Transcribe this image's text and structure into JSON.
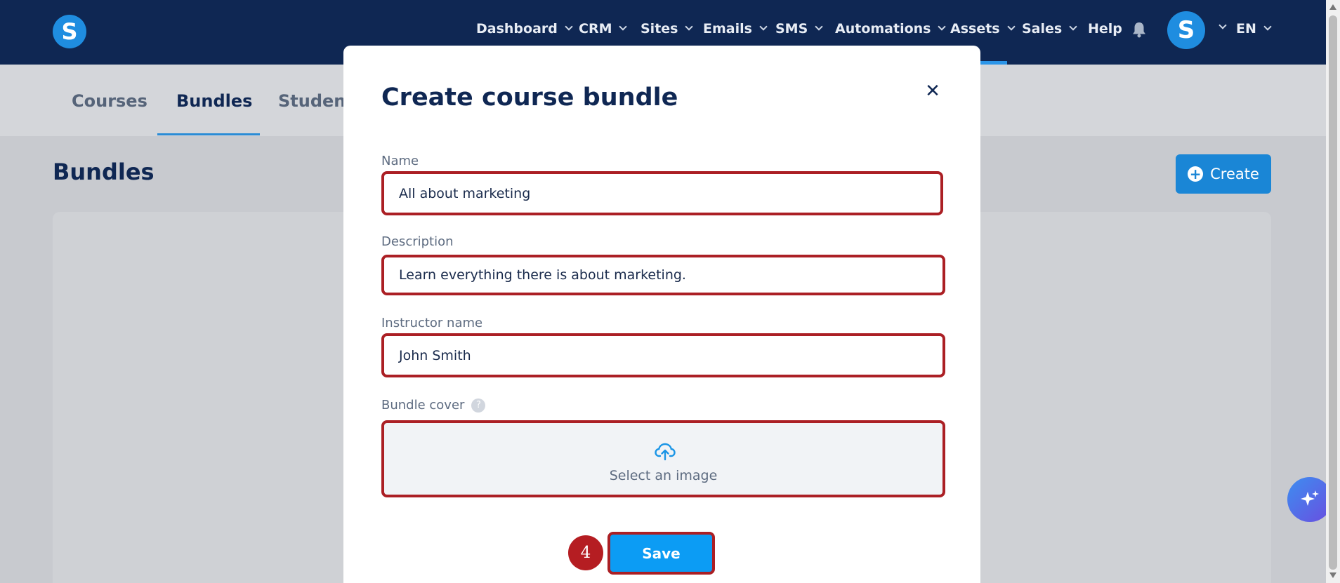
{
  "brand": {
    "logo_letter": "S"
  },
  "topnav": {
    "items": [
      {
        "label": "Dashboard",
        "has_menu": true
      },
      {
        "label": "CRM",
        "has_menu": true
      },
      {
        "label": "Sites",
        "has_menu": true
      },
      {
        "label": "Emails",
        "has_menu": true
      },
      {
        "label": "SMS",
        "has_menu": true
      },
      {
        "label": "Automations",
        "has_menu": true
      },
      {
        "label": "Assets",
        "has_menu": true,
        "active": true
      },
      {
        "label": "Sales",
        "has_menu": true
      },
      {
        "label": "Help",
        "has_menu": false
      }
    ],
    "notifications_icon": "bell-icon",
    "avatar_letter": "S",
    "language": "EN"
  },
  "tabs": [
    {
      "label": "Courses",
      "active": false
    },
    {
      "label": "Bundles",
      "active": true
    },
    {
      "label": "Students",
      "active": false
    }
  ],
  "page": {
    "title": "Bundles",
    "create_label": "Create"
  },
  "modal": {
    "title": "Create course bundle",
    "close_icon": "close-icon",
    "fields": {
      "name": {
        "label": "Name",
        "value": "All about marketing"
      },
      "description": {
        "label": "Description",
        "value": "Learn everything there is about marketing."
      },
      "instructor": {
        "label": "Instructor name",
        "value": "John Smith"
      },
      "cover": {
        "label": "Bundle cover",
        "help": "?",
        "upload_text": "Select an image",
        "icon": "cloud-upload-icon"
      }
    },
    "step_number": "4",
    "save_label": "Save"
  },
  "colors": {
    "nav_bg": "#0f2753",
    "accent": "#1a86d6",
    "highlight": "#ab1f24",
    "save_bg": "#0c9cf4"
  }
}
